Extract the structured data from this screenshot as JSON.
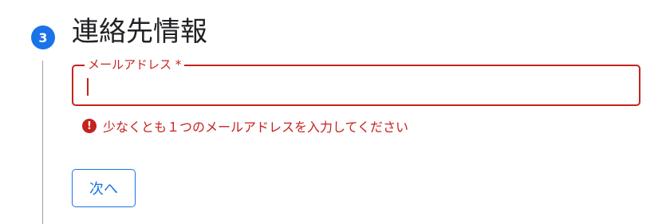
{
  "step": {
    "number": "3",
    "title": "連絡先情報"
  },
  "email_field": {
    "label": "メールアドレス *",
    "value": ""
  },
  "error": {
    "icon": "!",
    "message": "少なくとも１つのメールアドレスを入力してください"
  },
  "actions": {
    "next_label": "次へ"
  },
  "colors": {
    "accent": "#1a73e8",
    "error": "#c5221f",
    "text": "#202124",
    "step_line": "#9aa0a6"
  }
}
